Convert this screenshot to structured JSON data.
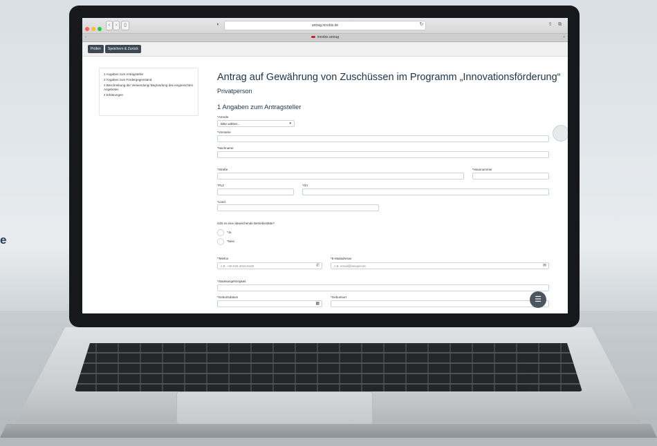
{
  "background": {
    "side_text": "e"
  },
  "browser": {
    "url": "antrag.innobis.de",
    "tab_title": "innobis antrag"
  },
  "toolbar": {
    "pruefen_label": "Prüfen",
    "save_label": "Speichern & Zurück"
  },
  "toc": {
    "items": [
      "1 Angaben zum Antragsteller",
      "2 Angaben zum Fördergegenstand",
      "3 Beschreibung der Verwendung/ Begründung des eingereichten Angebotes",
      "4 Erklärungen"
    ]
  },
  "form": {
    "title": "Antrag auf Gewährung von Zuschüssen im Programm „Innovationsförderung“",
    "subtitle": "Privatperson",
    "section_title": "1  Angaben zum Antragsteller",
    "anrede_label": "*Anrede",
    "anrede_value": "Bitte wählen...",
    "vorname_label": "*Vorname",
    "nachname_label": "*Nachname",
    "strasse_label": "*Straße",
    "hausnummer_label": "*Hausnummer",
    "plz_label": "*PLZ",
    "ort_label": "*Ort",
    "land_label": "*Land",
    "betrieb_question": "Gibt es eine abweichende Betriebsstätte?",
    "radio_ja": "*Ja",
    "radio_nein": "*Nein",
    "telefon_label": "*Telefon",
    "telefon_placeholder": "z.B. +49 040 4010-0100",
    "email_label": "*E-Mailadresse",
    "email_placeholder": "z.B. email@beispiel.de",
    "staatsangehoerigkeit_label": "*Staatsangehörigkeit",
    "geburtsdatum_label": "*Geburtsdatum",
    "geburtsort_label": "*Geburtsort"
  },
  "colors": {
    "accent_dark": "#3d4852",
    "title": "#1f3347"
  }
}
